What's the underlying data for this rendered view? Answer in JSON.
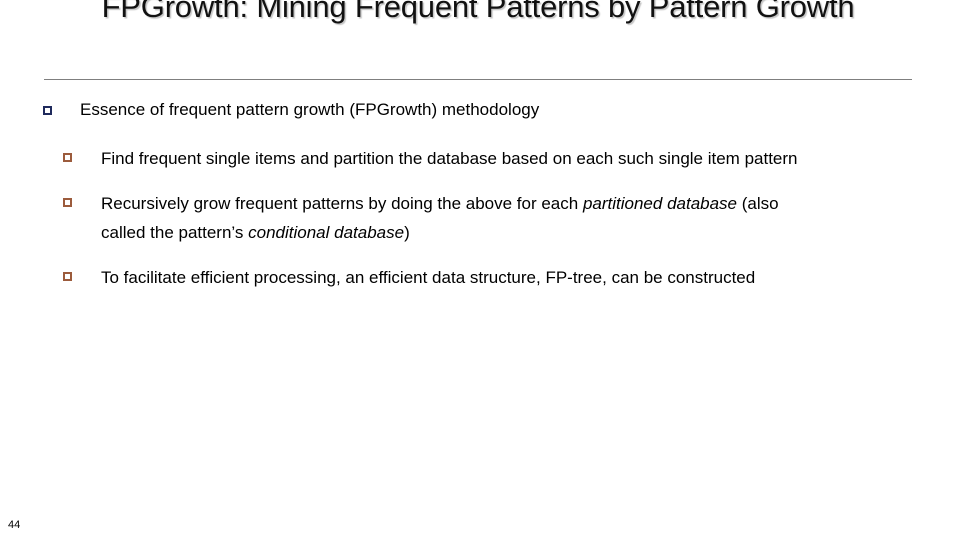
{
  "slide": {
    "title": "FPGrowth: Mining Frequent Patterns by Pattern Growth",
    "page_number": "44",
    "accent_colors": {
      "level1_bullet": "#1F2A5C",
      "level2_bullet": "#9C5B3C",
      "divider": "#7F7F7F",
      "text": "#000000",
      "background": "#FFFFFF"
    },
    "bullet_glyphs": {
      "level1": "hollow-square-navy",
      "level2": "hollow-square-brown"
    }
  },
  "content": {
    "level1": {
      "text": "Essence of frequent pattern growth (FPGrowth) methodology"
    },
    "level2": [
      {
        "id": "find-frequent-single-items",
        "segments": [
          {
            "text": "Find frequent single items and partition the database based on each such single item pattern",
            "italic": false
          }
        ]
      },
      {
        "id": "recursively-grow-patterns",
        "segments": [
          {
            "text": "Recursively grow frequent patterns by doing the above for each ",
            "italic": false
          },
          {
            "text": "partitioned database",
            "italic": true
          },
          {
            "text": " (also called the pattern’s ",
            "italic": false
          },
          {
            "text": "conditional database",
            "italic": true
          },
          {
            "text": ")",
            "italic": false
          }
        ]
      },
      {
        "id": "fp-tree-data-structure",
        "segments": [
          {
            "text": "To facilitate efficient processing, an efficient data structure, FP-tree, can be constructed",
            "italic": false
          }
        ]
      }
    ]
  }
}
